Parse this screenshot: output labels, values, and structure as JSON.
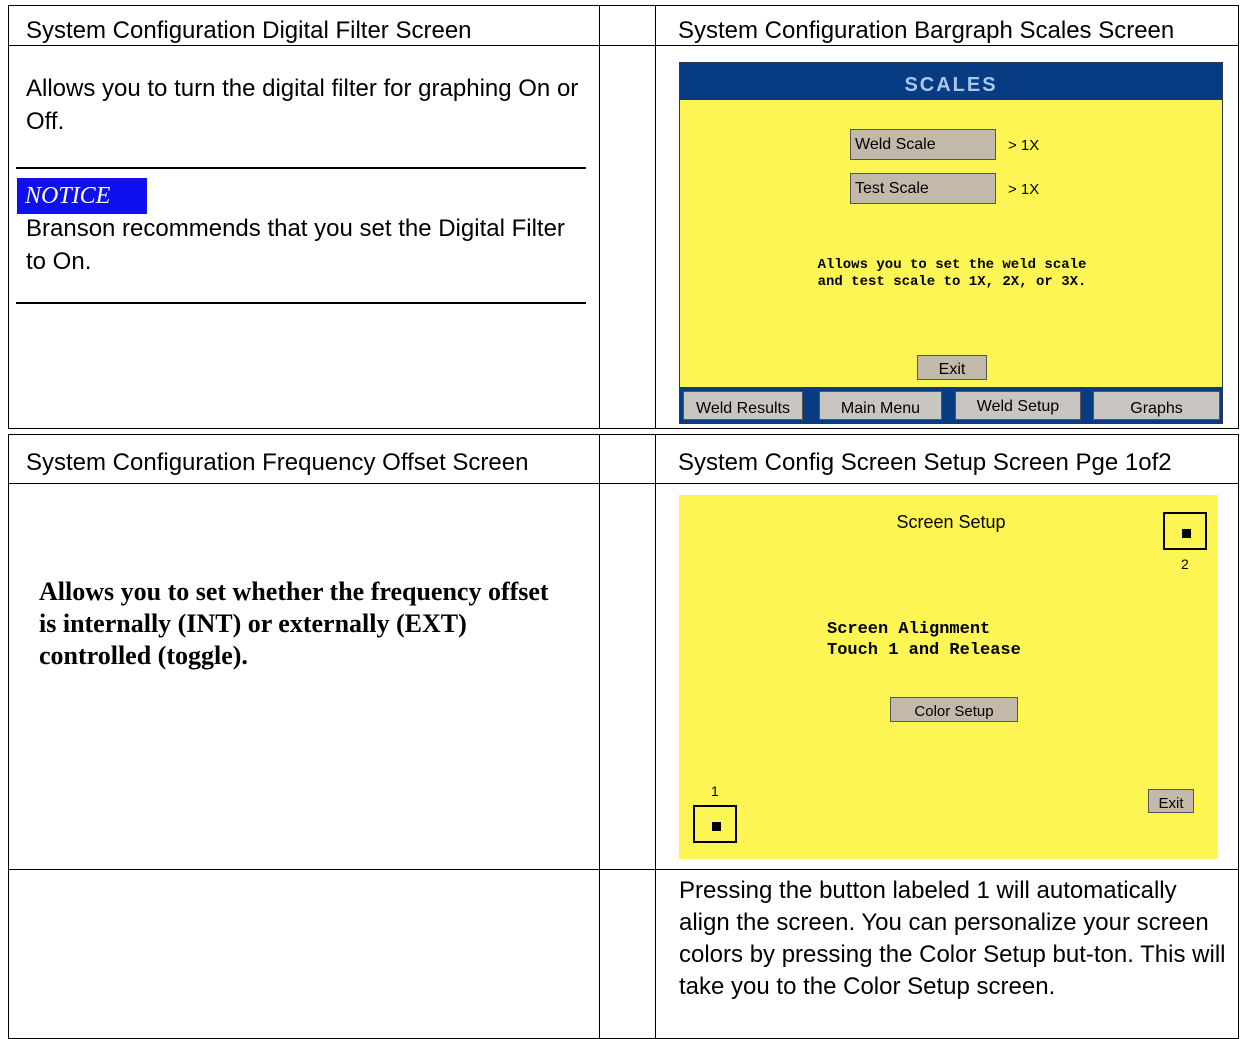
{
  "row1": {
    "left_header": "System Configuration Digital Filter Screen",
    "right_header": "System Configuration Bargraph Scales Screen",
    "description": "Allows you to turn the digital filter for graphing On or Off.",
    "notice_label": "NOTICE",
    "notice_text": "Branson recommends that you set the Digital Filter to On."
  },
  "scales_screen": {
    "title": "SCALES",
    "weld_scale_label": "Weld Scale",
    "weld_scale_value": "> 1X",
    "test_scale_label": "Test Scale",
    "test_scale_value": "> 1X",
    "message": "Allows you to set the weld scale\nand test scale to 1X, 2X, or 3X.",
    "exit_label": "Exit",
    "nav": [
      "Weld Results",
      "Main Menu",
      "Weld Setup",
      "Graphs"
    ],
    "colors": {
      "background": "#fcf553",
      "title_bar": "#073b82"
    }
  },
  "row2": {
    "left_header": "System Configuration Frequency Offset Screen",
    "right_header": "System Config Screen Setup Screen Pge 1of2",
    "description": "Allows you to set whether the frequency offset is internally (INT) or externally (EXT) controlled (toggle)."
  },
  "screen_setup": {
    "title": "Screen Setup",
    "target_1_label": "1",
    "target_2_label": "2",
    "message": "Screen Alignment\nTouch 1 and Release",
    "color_setup_label": "Color Setup",
    "exit_label": "Exit"
  },
  "row3": {
    "right_text": "Pressing the button labeled 1 will automatically align the screen. You can personalize your screen colors by pressing the Color Setup but-ton. This will take you to the Color Setup screen."
  }
}
